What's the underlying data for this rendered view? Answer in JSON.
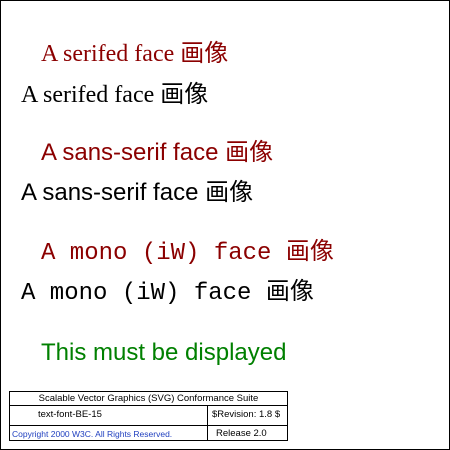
{
  "tests": {
    "serif_red": "A serifed face 画像",
    "serif_black": "A serifed face 画像",
    "sans_red": "A sans-serif face 画像",
    "sans_black": "A sans-serif face 画像",
    "mono_red": "A mono (iW) face 画像",
    "mono_black": "A mono (iW) face 画像",
    "must_display": "This must be displayed"
  },
  "footer": {
    "suite_title": "Scalable Vector Graphics (SVG) Conformance Suite",
    "test_id": "text-font-BE-15",
    "revision": "$Revision: 1.8 $",
    "copyright": "Copyright 2000 W3C. All Rights Reserved.",
    "release": "Release 2.0"
  },
  "colors": {
    "red": "#8b0000",
    "green": "#008000",
    "copyright_blue": "#1f3fbf"
  }
}
